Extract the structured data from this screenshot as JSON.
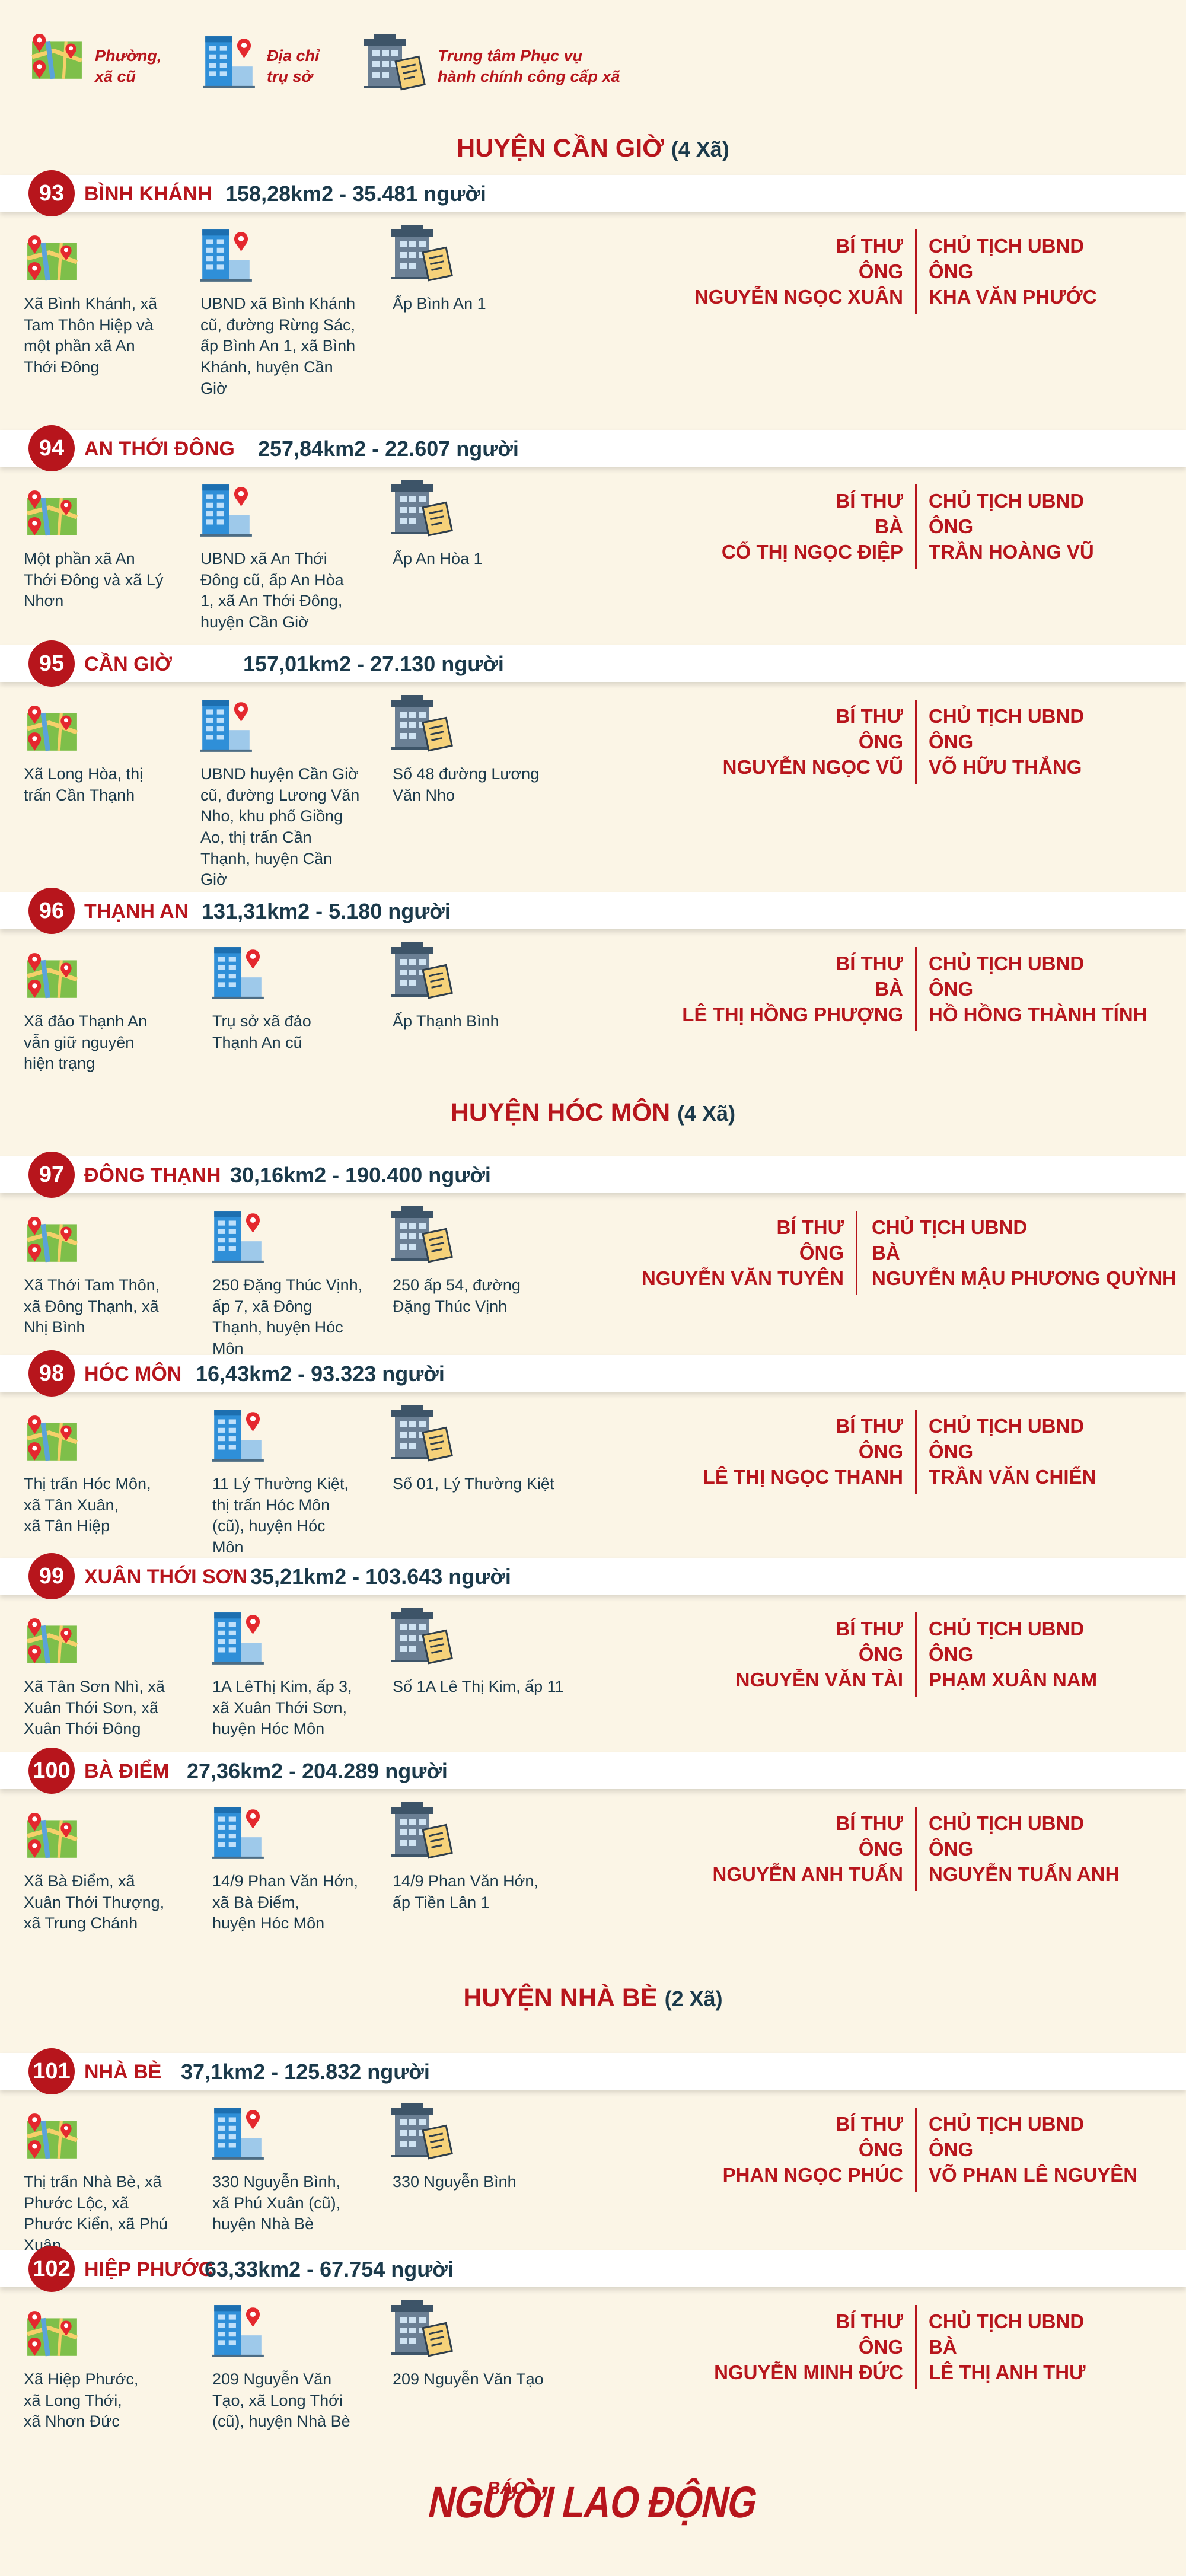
{
  "legend": [
    {
      "icon": "map-pin-icon",
      "label": "Phường,\nxã cũ"
    },
    {
      "icon": "office-building-pin-icon",
      "label": "Địa chỉ\ntrụ sở"
    },
    {
      "icon": "service-center-building-icon",
      "label": "Trung tâm Phục vụ\nhành chính công cấp xã"
    }
  ],
  "districts": [
    {
      "name": "HUYỆN CẦN GIỜ",
      "count": "(4 Xã)"
    },
    {
      "name": "HUYỆN HÓC MÔN",
      "count": "(4 Xã)"
    },
    {
      "name": "HUYỆN NHÀ BÈ",
      "count": "(2 Xã)"
    }
  ],
  "labels": {
    "bi_thu": "BÍ THƯ",
    "chu_tich": "CHỦ TỊCH UBND"
  },
  "wards": [
    {
      "num": "93",
      "name": "BÌNH KHÁNH",
      "stat": "158,28km2 -  35.481 người",
      "old": "Xã Bình Khánh, xã\nTam Thôn Hiệp và\nmột phần xã An\nThới Đông",
      "addr": "UBND xã Bình Khánh\ncũ, đường Rừng Sác,\nấp Bình An 1, xã Bình\nKhánh, huyện Cần\nGiờ",
      "center": "Ấp Bình An 1",
      "bt_title": "ÔNG",
      "bt_name": "NGUYỄN NGỌC XUÂN",
      "ct_title": "ÔNG",
      "ct_name": "KHA VĂN PHƯỚC"
    },
    {
      "num": "94",
      "name": "AN THỚI ĐÔNG",
      "stat": "257,84km2 -  22.607 người",
      "old": "Một phần xã An\nThới Đông và xã Lý\nNhơn",
      "addr": "UBND xã An Thới\nĐông cũ, ấp An Hòa\n1, xã An Thới Đông,\nhuyện Cần Giờ",
      "center": "Ấp An Hòa 1",
      "bt_title": "BÀ",
      "bt_name": "CỔ THỊ NGỌC ĐIỆP",
      "ct_title": "ÔNG",
      "ct_name": "TRẦN HOÀNG VŨ"
    },
    {
      "num": "95",
      "name": "CẦN GIỜ",
      "stat": "157,01km2 -  27.130 người",
      "old": "Xã Long Hòa, thị\ntrấn Cần Thạnh",
      "addr": "UBND huyện Cần Giờ\ncũ, đường Lương Văn\nNho, khu phố Giồng\nAo, thị trấn Cần\nThạnh, huyện Cần\nGiờ",
      "center": "Số 48 đường Lương\nVăn Nho",
      "bt_title": "ÔNG",
      "bt_name": "NGUYỄN NGỌC VŨ",
      "ct_title": "ÔNG",
      "ct_name": "VÕ HỮU THẮNG"
    },
    {
      "num": "96",
      "name": "THẠNH AN",
      "stat": "131,31km2 -  5.180 người",
      "old": "Xã đảo Thạnh An\nvẫn giữ nguyên\nhiện trạng",
      "addr": "Trụ sở xã đảo\nThạnh An cũ",
      "center": "Ấp Thạnh Bình",
      "bt_title": "BÀ",
      "bt_name": "LÊ THỊ HỒNG PHƯỢNG",
      "ct_title": "ÔNG",
      "ct_name": "HỒ HỒNG THÀNH TÍNH"
    },
    {
      "num": "97",
      "name": "ĐÔNG THẠNH",
      "stat": "30,16km2 - 190.400 người",
      "old": "Xã Thới Tam Thôn,\nxã Đông Thạnh, xã\nNhị Bình",
      "addr": "250 Đặng Thúc Vịnh,\nấp 7, xã Đông\nThạnh, huyện Hóc\nMôn",
      "center": "250 ấp 54, đường\nĐặng Thúc Vịnh",
      "bt_title": "ÔNG",
      "bt_name": "NGUYỄN VĂN TUYÊN",
      "ct_title": "BÀ",
      "ct_name": "NGUYỄN MẬU PHƯƠNG QUỲNH"
    },
    {
      "num": "98",
      "name": "HÓC MÔN",
      "stat": "16,43km2 - 93.323 người",
      "old": "Thị trấn Hóc Môn,\nxã Tân Xuân,\nxã Tân Hiệp",
      "addr": "11 Lý Thường Kiệt,\nthị trấn Hóc Môn\n(cũ), huyện Hóc\nMôn",
      "center": "Số 01, Lý Thường Kiệt",
      "bt_title": "ÔNG",
      "bt_name": "LÊ THỊ NGỌC THANH",
      "ct_title": "ÔNG",
      "ct_name": "TRẦN VĂN CHIẾN"
    },
    {
      "num": "99",
      "name": "XUÂN THỚI SƠN",
      "stat": "35,21km2 - 103.643 người",
      "old": "Xã Tân Sơn Nhì, xã\nXuân Thới Sơn, xã\nXuân Thới Đông",
      "addr": "1A LêThị Kim, ấp 3,\nxã Xuân Thới Sơn,\nhuyện Hóc Môn",
      "center": "Số 1A Lê Thị Kim, ấp 11",
      "bt_title": "ÔNG",
      "bt_name": "NGUYỄN VĂN TÀI",
      "ct_title": "ÔNG",
      "ct_name": "PHẠM XUÂN NAM"
    },
    {
      "num": "100",
      "name": "BÀ ĐIỂM",
      "stat": "27,36km2 - 204.289 người",
      "old": "Xã Bà Điểm, xã\nXuân Thới Thượng,\nxã Trung Chánh",
      "addr": "14/9 Phan Văn Hớn,\nxã Bà Điểm,\nhuyện Hóc Môn",
      "center": "14/9 Phan Văn Hớn,\nấp Tiền Lân 1",
      "bt_title": "ÔNG",
      "bt_name": "NGUYỄN ANH TUẤN",
      "ct_title": "ÔNG",
      "ct_name": "NGUYỄN TUẤN ANH"
    },
    {
      "num": "101",
      "name": "NHÀ BÈ",
      "stat": "37,1km2 -  125.832 người",
      "old": "Thị trấn Nhà Bè, xã\nPhước Lộc, xã\nPhước Kiển, xã Phú\nXuân",
      "addr": "330 Nguyễn Bình,\nxã Phú Xuân (cũ),\nhuyện Nhà Bè",
      "center": "330 Nguyễn Bình",
      "bt_title": "ÔNG",
      "bt_name": "PHAN NGỌC PHÚC",
      "ct_title": "ÔNG",
      "ct_name": "VÕ PHAN LÊ NGUYÊN"
    },
    {
      "num": "102",
      "name": "HIỆP PHƯỚC",
      "stat": "63,33km2 - 67.754 người",
      "old": "Xã Hiệp Phước,\nxã Long Thới,\nxã Nhơn Đức",
      "addr": "209 Nguyễn Văn\nTạo, xã Long Thới\n(cũ), huyện Nhà Bè",
      "center": "209 Nguyễn Văn Tạo",
      "bt_title": "ÔNG",
      "bt_name": "NGUYỄN MINH ĐỨC",
      "ct_title": "BÀ",
      "ct_name": "LÊ THỊ ANH THƯ"
    }
  ],
  "logo": {
    "small": "BÁO",
    "main": "NGƯỜI LAO ĐỘNG"
  },
  "colors": {
    "accent": "#b7151c",
    "text": "#1b3a4b",
    "background": "#fbf5e6"
  }
}
